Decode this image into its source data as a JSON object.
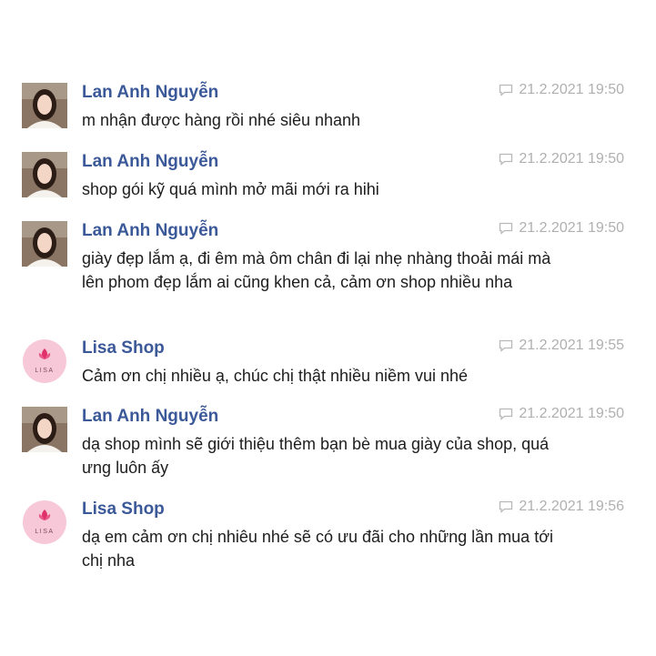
{
  "messages": [
    {
      "author": "Lan Anh Nguyễn",
      "time": "21.2.2021 19:50",
      "avatar": "customer-photo",
      "text": "m nhận được hàng rồi nhé siêu nhanh"
    },
    {
      "author": "Lan Anh Nguyễn",
      "time": "21.2.2021 19:50",
      "avatar": "customer-photo",
      "text": "shop gói kỹ quá mình mở mãi mới ra hihi"
    },
    {
      "author": "Lan Anh Nguyễn",
      "time": "21.2.2021 19:50",
      "avatar": "customer-photo",
      "text": "giày đẹp lắm ạ, đi êm mà ôm chân đi lại nhẹ nhàng thoải mái mà lên phom đẹp lắm ai cũng khen cả, cảm ơn shop nhiều nha"
    },
    {
      "author": "Lisa Shop",
      "time": "21.2.2021 19:55",
      "avatar": "lisa-logo",
      "text": "Cảm ơn chị nhiều ạ, chúc chị thật nhiều niềm vui nhé"
    },
    {
      "author": "Lan Anh Nguyễn",
      "time": "21.2.2021 19:50",
      "avatar": "customer-photo",
      "text": "dạ shop mình sẽ giới thiệu thêm bạn bè mua giày của shop, quá ưng luôn ấy"
    },
    {
      "author": "Lisa Shop",
      "time": "21.2.2021 19:56",
      "avatar": "lisa-logo",
      "text": "dạ em cảm ơn chị nhiêu nhé sẽ có ưu đãi cho những lần mua tới chị nha"
    }
  ],
  "brand": {
    "logo_text": "LISA"
  },
  "colors": {
    "name": "#3b5998",
    "time": "#b0b0b0",
    "text": "#1d1d1d",
    "logo_circle": "#f7c8d8",
    "logo_flower": "#e0306a"
  }
}
